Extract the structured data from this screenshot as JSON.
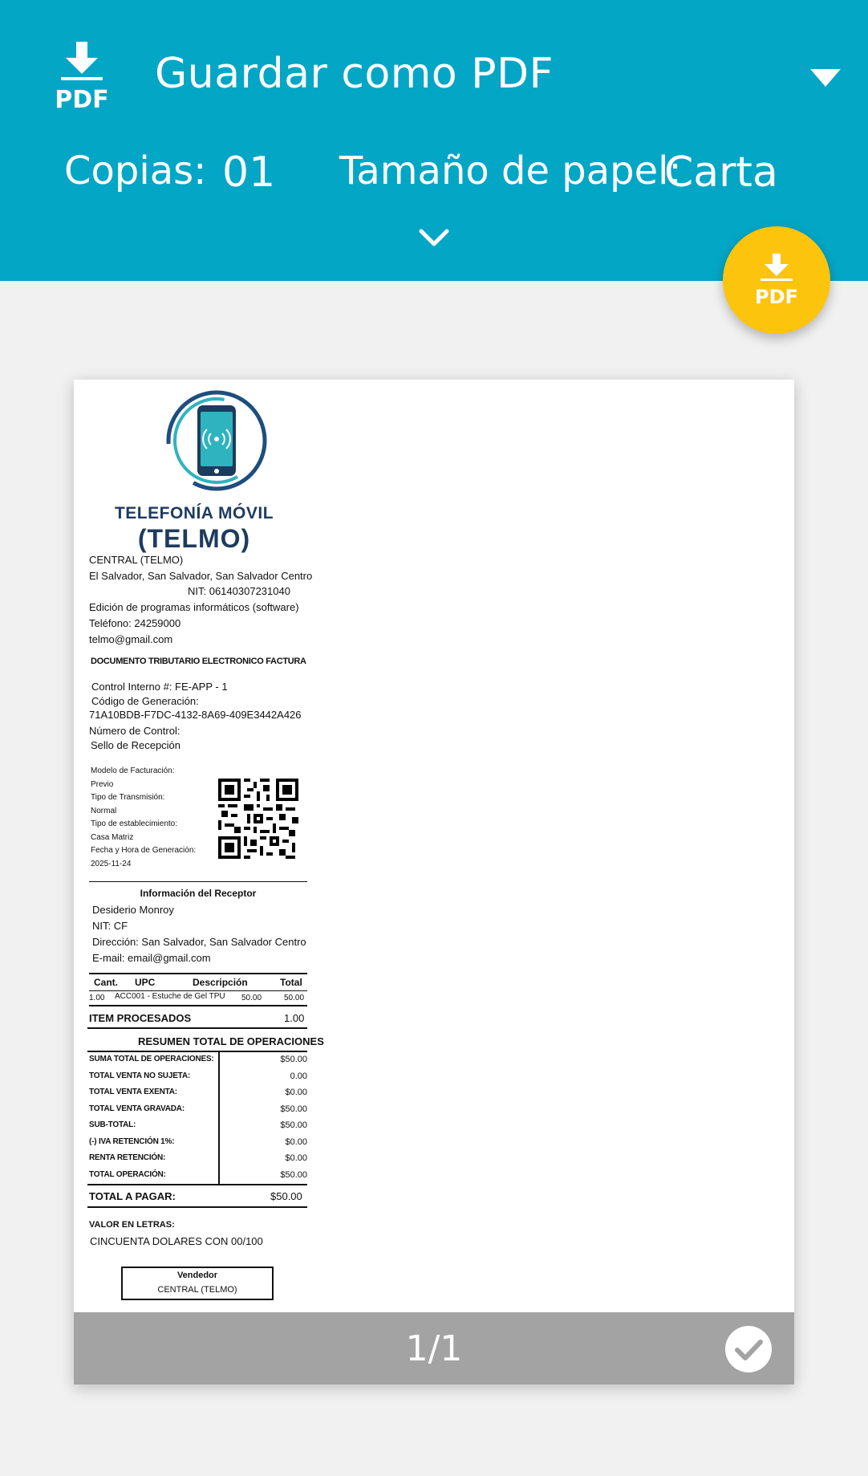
{
  "header": {
    "destination_title": "Guardar como PDF",
    "copies_label": "Copias:",
    "copies_value": "01",
    "paper_label": "Tamaño de papel:",
    "paper_value": "Carta",
    "pdf_icon_text": "PDF",
    "colors": {
      "bar": "#04a6c6",
      "fab": "#fcc40c"
    }
  },
  "preview": {
    "pager": "1/1"
  },
  "receipt": {
    "brand_line1": "TELEFONÍA MÓVIL",
    "brand_line2": "(TELMO)",
    "issuer": {
      "name": "CENTRAL (TELMO)",
      "address": "El Salvador, San Salvador, San Salvador Centro",
      "nit": "NIT: 06140307231040",
      "activity": "Edición de programas informáticos (software)",
      "phone": "Teléfono: 24259000",
      "email": "telmo@gmail.com"
    },
    "doc_type": "DOCUMENTO TRIBUTARIO ELECTRONICO FACTURA",
    "control_interno": "Control Interno #: FE-APP - 1",
    "codigo_label": "Código de Generación:",
    "codigo_value": "71A10BDB-F7DC-4132-8A69-409E3442A426",
    "numero_control": "Número de Control:",
    "sello": "Sello de Recepción",
    "meta": [
      {
        "label": "Modelo de Facturación:",
        "value": "Previo"
      },
      {
        "label": "Tipo de Transmisión:",
        "value": "Normal"
      },
      {
        "label": "Tipo de establecimiento:",
        "value": "Casa Matriz"
      },
      {
        "label": "Fecha y Hora de Generación:",
        "value": "2025-11-24"
      }
    ],
    "receptor": {
      "title": "Información del Receptor",
      "name": "Desiderio Monroy",
      "nit": "NIT: CF",
      "address": "Dirección: San Salvador, San Salvador Centro",
      "email": "E-mail: email@gmail.com"
    },
    "items_table": {
      "headers": [
        "Cant.",
        "UPC",
        "Descripción",
        "Total"
      ],
      "rows": [
        {
          "qty": "1.00",
          "desc": "ACC001 - Estuche de Gel TPU",
          "price": "50.00",
          "total": "50.00"
        }
      ]
    },
    "items_processed_label": "ITEM PROCESADOS",
    "items_processed_value": "1.00",
    "summary_title": "RESUMEN TOTAL DE OPERACIONES",
    "summary": [
      {
        "label": "SUMA TOTAL DE OPERACIONES:",
        "value": "$50.00"
      },
      {
        "label": "TOTAL VENTA NO SUJETA:",
        "value": "0.00"
      },
      {
        "label": "TOTAL VENTA EXENTA:",
        "value": "$0.00"
      },
      {
        "label": "TOTAL VENTA GRAVADA:",
        "value": "$50.00"
      },
      {
        "label": "SUB-TOTAL:",
        "value": "$50.00"
      },
      {
        "label": "(-) IVA RETENCIÓN 1%:",
        "value": "$0.00"
      },
      {
        "label": "RENTA RETENCIÓN:",
        "value": "$0.00"
      },
      {
        "label": "TOTAL OPERACIÓN:",
        "value": "$50.00"
      }
    ],
    "total_pagar_label": "TOTAL A PAGAR:",
    "total_pagar_value": "$50.00",
    "valor_letras_label": "VALOR EN LETRAS:",
    "valor_letras_value": "CINCUENTA DOLARES CON 00/100",
    "vendedor_label": "Vendedor",
    "vendedor_value": "CENTRAL (TELMO)"
  }
}
